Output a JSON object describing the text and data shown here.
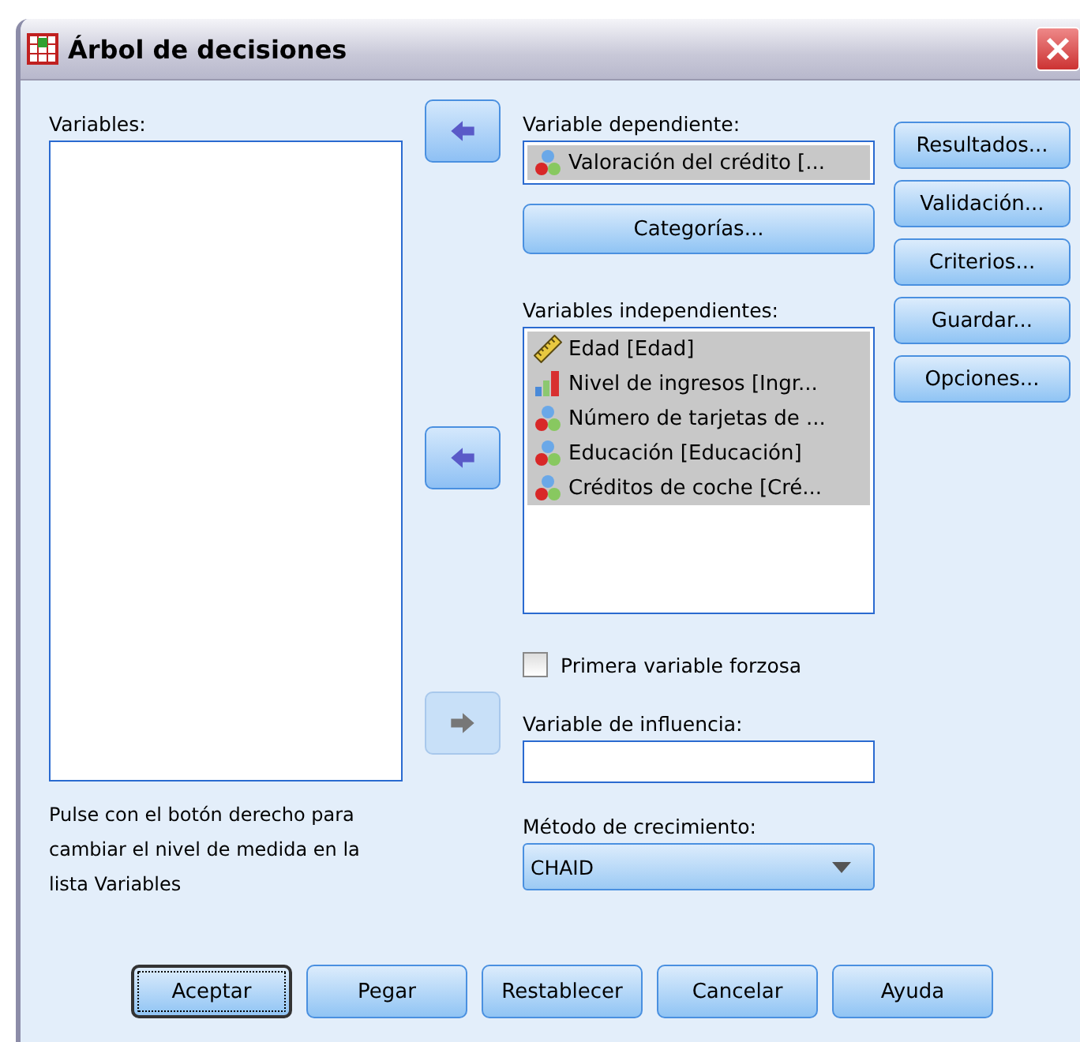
{
  "window": {
    "title": "Árbol de decisiones"
  },
  "variables": {
    "label": "Variables:"
  },
  "note": "Pulse con el botón derecho para cambiar el nivel de medida en la lista Variables",
  "arrows": [
    {
      "kind": "left",
      "disabled": false
    },
    {
      "kind": "left",
      "disabled": false
    },
    {
      "kind": "right",
      "disabled": true
    }
  ],
  "dependent": {
    "label": "Variable dependiente:",
    "item": {
      "kind": "nominal",
      "text": "Valoración del crédito [...",
      "selected": true
    }
  },
  "categories_button": "Categorías...",
  "independent": {
    "label": "Variables independientes:",
    "items": [
      {
        "kind": "scale",
        "text": "Edad [Edad]",
        "selected": true
      },
      {
        "kind": "ordinal",
        "text": "Nivel de ingresos [Ingr...",
        "selected": true
      },
      {
        "kind": "nominal",
        "text": "Número de tarjetas de ...",
        "selected": true
      },
      {
        "kind": "nominal",
        "text": "Educación [Educación]",
        "selected": true
      },
      {
        "kind": "nominal",
        "text": "Créditos de coche [Cré...",
        "selected": true
      }
    ]
  },
  "force_first": {
    "label": "Primera variable forzosa",
    "checked": false
  },
  "influence": {
    "label": "Variable de influencia:"
  },
  "growth": {
    "label": "Método de crecimiento:",
    "value": "CHAID"
  },
  "side_buttons": [
    "Resultados...",
    "Validación...",
    "Criterios...",
    "Guardar...",
    "Opciones..."
  ],
  "buttons": [
    {
      "label": "Aceptar",
      "default": true
    },
    {
      "label": "Pegar",
      "default": false
    },
    {
      "label": "Restablecer",
      "default": false
    },
    {
      "label": "Cancelar",
      "default": false
    },
    {
      "label": "Ayuda",
      "default": false
    }
  ]
}
